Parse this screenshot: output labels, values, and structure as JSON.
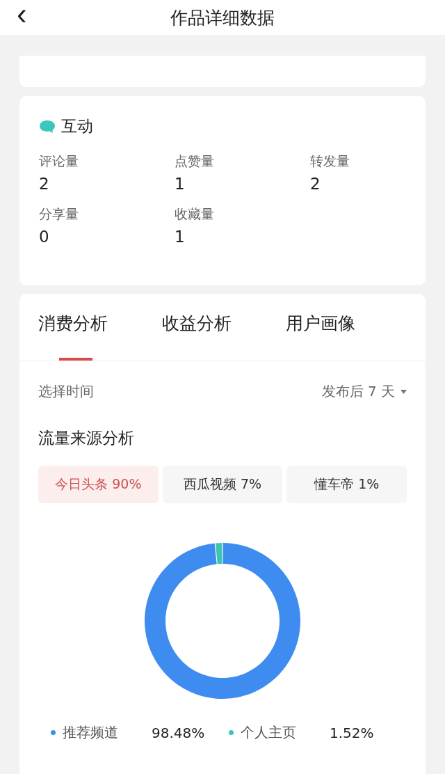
{
  "header": {
    "back_icon": "‹",
    "title": "作品详细数据"
  },
  "interaction": {
    "title": "互动",
    "metrics": [
      {
        "label": "评论量",
        "value": "2"
      },
      {
        "label": "点赞量",
        "value": "1"
      },
      {
        "label": "转发量",
        "value": "2"
      },
      {
        "label": "分享量",
        "value": "0"
      },
      {
        "label": "收藏量",
        "value": "1"
      }
    ]
  },
  "tabs": [
    {
      "label": "消费分析",
      "selected": true
    },
    {
      "label": "收益分析",
      "selected": false
    },
    {
      "label": "用户画像",
      "selected": false
    }
  ],
  "time_filter": {
    "label": "选择时间",
    "value": "发布后 7 天"
  },
  "traffic": {
    "title": "流量来源分析",
    "sources": [
      {
        "name": "今日头条",
        "percent": "90%",
        "selected": true
      },
      {
        "name": "西瓜视频",
        "percent": "7%",
        "selected": false
      },
      {
        "name": "懂车帝",
        "percent": "1%",
        "selected": false
      }
    ],
    "chart_data": {
      "type": "donut",
      "categories": [
        "推荐频道",
        "个人主页"
      ],
      "values": [
        98.48,
        1.52
      ],
      "value_labels": [
        "98.48%",
        "1.52%"
      ]
    },
    "legend": [
      {
        "color": "#3f8cf0"
      },
      {
        "color": "#3cc6b0"
      }
    ]
  }
}
